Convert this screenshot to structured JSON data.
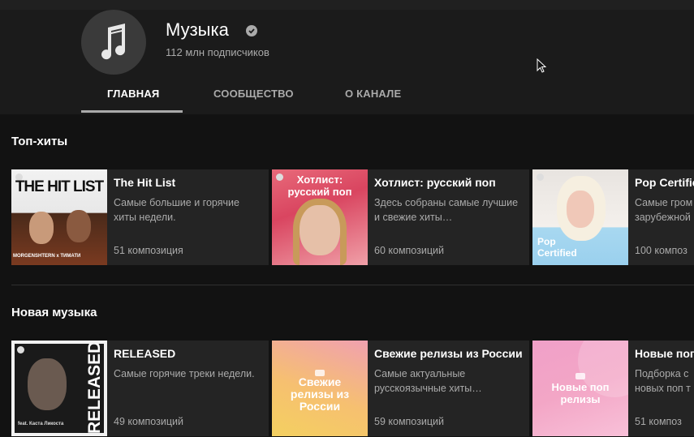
{
  "channel": {
    "name": "Музыка",
    "subscribers": "112 млн подписчиков",
    "avatar_icon": "music-note-icon"
  },
  "tabs": [
    {
      "label": "ГЛАВНАЯ",
      "active": true
    },
    {
      "label": "СООБЩЕСТВО",
      "active": false
    },
    {
      "label": "О КАНАЛЕ",
      "active": false
    }
  ],
  "sections": [
    {
      "title": "Топ-хиты",
      "cards": [
        {
          "title": "The Hit List",
          "description": "Самые большие и горячие хиты недели.",
          "count": "51 композиция",
          "thumb_text": "THE HIT LIST",
          "thumb_caption": "MORGENSHTERN x ТИМАТИ"
        },
        {
          "title": "Хотлист: русский поп",
          "description": "Здесь собраны самые лучшие и свежие хиты…",
          "count": "60 композиций",
          "thumb_text": "Хотлист: русский поп"
        },
        {
          "title": "Pop Certifie",
          "description": "Самые гром зарубежной",
          "count": "100 композ",
          "thumb_text": "Pop Certified"
        }
      ]
    },
    {
      "title": "Новая музыка",
      "cards": [
        {
          "title": "RELEASED",
          "description": "Самые горячие треки недели.",
          "count": "49 композиций",
          "thumb_text": "RELEASED",
          "thumb_caption": "feat. Каста Ликоста"
        },
        {
          "title": "Свежие релизы из России",
          "description": "Самые актуальные русскоязычные хиты…",
          "count": "59 композиций",
          "thumb_text": "Свежие релизы из России"
        },
        {
          "title": "Новые поп",
          "description": "Подборка с новых поп т",
          "count": "51 композ",
          "thumb_text": "Новые поп релизы"
        }
      ]
    }
  ]
}
